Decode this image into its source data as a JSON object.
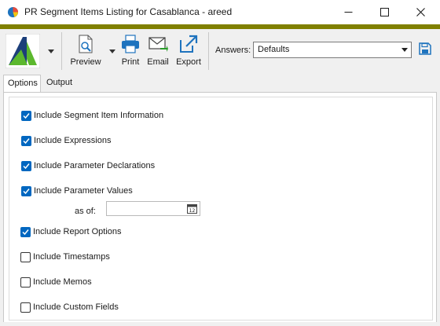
{
  "window": {
    "title": "PR Segment Items Listing for Casablanca - areed"
  },
  "toolbar": {
    "preview_label": "Preview",
    "print_label": "Print",
    "email_label": "Email",
    "export_label": "Export",
    "answers_label": "Answers:",
    "answers_value": "Defaults"
  },
  "tabs": [
    {
      "label": "Options",
      "active": true
    },
    {
      "label": "Output",
      "active": false
    }
  ],
  "options": {
    "items": [
      {
        "label": "Include Segment Item Information",
        "checked": true
      },
      {
        "label": "Include Expressions",
        "checked": true
      },
      {
        "label": "Include Parameter Declarations",
        "checked": true
      },
      {
        "label": "Include Parameter Values",
        "checked": true
      },
      {
        "label": "Include Report Options",
        "checked": true
      },
      {
        "label": "Include Timestamps",
        "checked": false
      },
      {
        "label": "Include Memos",
        "checked": false
      },
      {
        "label": "Include Custom Fields",
        "checked": false
      }
    ],
    "as_of_label": "as of:",
    "as_of_value": ""
  },
  "colors": {
    "accent_bar": "#808000",
    "checkbox_checked": "#0067c0",
    "logo_green": "#5cb82e",
    "logo_navy": "#1c3f7a",
    "icon_blue": "#1e73be"
  },
  "icons": {
    "app": "pie-chart-icon",
    "logo": "company-logo",
    "preview": "document-search-icon",
    "print": "printer-icon",
    "email": "envelope-icon",
    "export": "export-arrow-icon",
    "save": "floppy-disk-icon",
    "calendar": "calendar-icon"
  }
}
